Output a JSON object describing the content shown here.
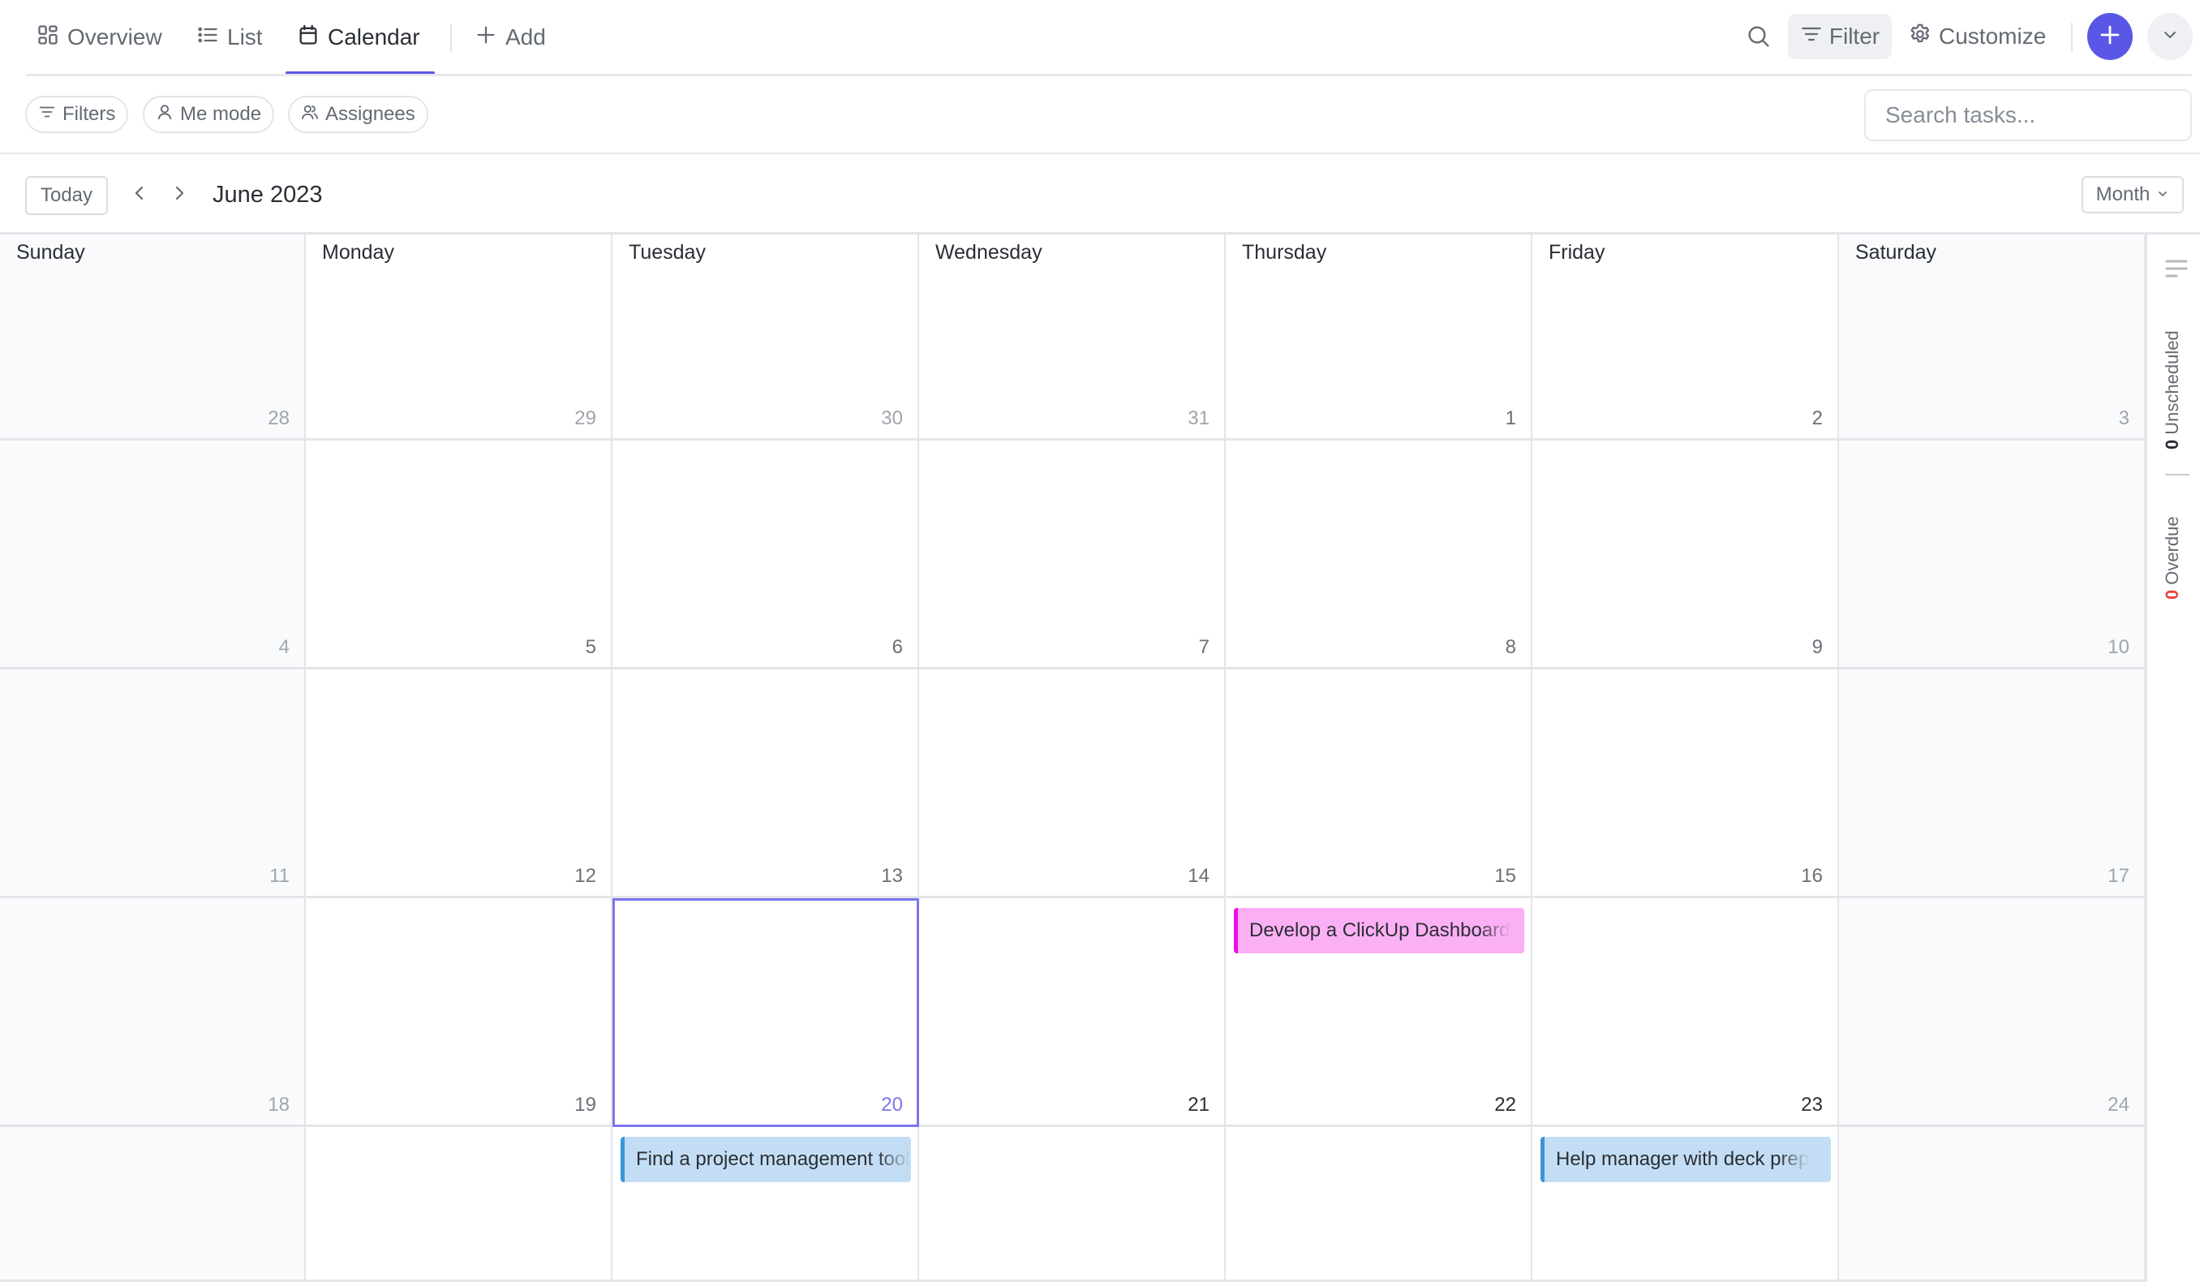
{
  "nav": {
    "tabs": [
      {
        "label": "Overview",
        "icon": "grid-icon"
      },
      {
        "label": "List",
        "icon": "list-icon"
      },
      {
        "label": "Calendar",
        "icon": "calendar-icon",
        "active": true
      }
    ],
    "add_label": "Add",
    "filter_label": "Filter",
    "customize_label": "Customize",
    "accent_color": "#5b57e6"
  },
  "filters": {
    "chips": [
      {
        "label": "Filters",
        "icon": "filter-icon"
      },
      {
        "label": "Me mode",
        "icon": "user-icon"
      },
      {
        "label": "Assignees",
        "icon": "users-icon"
      }
    ],
    "search_placeholder": "Search tasks..."
  },
  "calendar": {
    "today_label": "Today",
    "month_label": "June 2023",
    "view_label": "Month",
    "weekdays": [
      "Sunday",
      "Monday",
      "Tuesday",
      "Wednesday",
      "Thursday",
      "Friday",
      "Saturday"
    ],
    "weeks": [
      [
        "28",
        "29",
        "30",
        "31",
        "1",
        "2",
        "3"
      ],
      [
        "4",
        "5",
        "6",
        "7",
        "8",
        "9",
        "10"
      ],
      [
        "11",
        "12",
        "13",
        "14",
        "15",
        "16",
        "17"
      ],
      [
        "18",
        "19",
        "20",
        "21",
        "22",
        "23",
        "24"
      ],
      [
        "",
        "",
        "",
        "",
        "",
        "",
        ""
      ]
    ],
    "selected_day": "20",
    "events": [
      {
        "title": "Develop a ClickUp Dashboard",
        "week": 3,
        "day": 4,
        "bg": "#fbb0f5",
        "bar": "#ee0be5"
      },
      {
        "title": "Find a project management tool",
        "week": 4,
        "day": 2,
        "bg": "#c3def4",
        "bar": "#3b96d8"
      },
      {
        "title": "Help manager with deck prep",
        "week": 4,
        "day": 5,
        "bg": "#c3def4",
        "bar": "#3b96d8"
      }
    ]
  },
  "side_rail": {
    "unscheduled_count": "0",
    "unscheduled_label": "Unscheduled",
    "overdue_count": "0",
    "overdue_label": "Overdue",
    "overdue_color": "#e5483d"
  }
}
